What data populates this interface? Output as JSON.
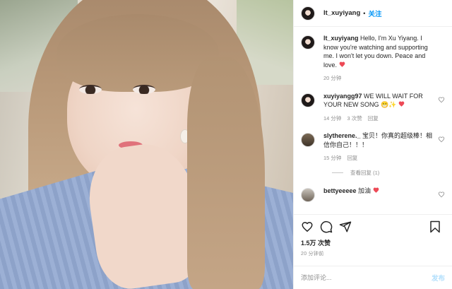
{
  "post": {
    "username": "lt_xuyiyang",
    "header_dot": "•",
    "follow_label": "关注",
    "caption": {
      "username": "lt_xuyiyang",
      "text": "Hello, I'm Xu Yiyang. I know you're watching and supporting me. I won't let you down. Peace and love.",
      "time": "20 分钟"
    },
    "comments": [
      {
        "username": "xuyiyangg97",
        "text": "WE WILL WAIT FOR YOUR NEW SONG",
        "emoji": "😁✨",
        "time": "14 分钟",
        "likes": "3 次赞",
        "reply": "回复"
      },
      {
        "username": "slytherene._",
        "text": "宝贝！你真的超级棒！相信你自己！！！",
        "time": "15 分钟",
        "reply": "回复",
        "view_replies": "查看回复 (1)"
      },
      {
        "username": "bettyeeeee",
        "text": "加油"
      }
    ],
    "likes_count": "1.5万 次赞",
    "posted_time": "20 分钟前",
    "add_comment_placeholder": "添加评论...",
    "post_button": "发布"
  },
  "icons": {
    "heart_outline": "heart-icon",
    "comment": "comment-icon",
    "share": "share-icon",
    "bookmark": "bookmark-icon"
  },
  "colors": {
    "accent": "#0095f6",
    "like_red": "#ed4956",
    "muted": "#8e8e8e",
    "post_disabled": "#b2dffc"
  }
}
